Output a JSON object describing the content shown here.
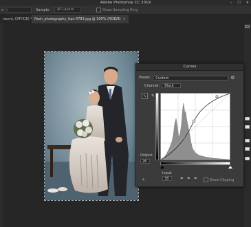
{
  "window": {
    "title": "Adobe Photoshop CC 2019",
    "controls": [
      "–",
      "☐",
      "✕"
    ]
  },
  "options_bar": {
    "sample_label": "Sample:",
    "sample_value": "All Layers",
    "show_sampling_ring": "Show Sampling Ring"
  },
  "tabs": [
    {
      "label": "round, CMYK/8) *",
      "active": false
    },
    {
      "label": "flash_photography_tips-0783.jpg @ 100% (RGB/8)",
      "active": true
    }
  ],
  "curves": {
    "title": "Curves",
    "preset_label": "Preset:",
    "preset_value": "Custom",
    "channel_label": "Channel:",
    "channel_value": "Black",
    "output_label": "Output:",
    "output_value": "26",
    "input_label": "Input:",
    "input_value": "38",
    "show_clipping": "Show Clipping"
  },
  "icons": {
    "curve_tool": "curve-point-icon",
    "pencil_tool": "pencil-icon",
    "auto": "auto-adjust-icon",
    "black_eyedropper": "black-eyedropper-icon",
    "gray_eyedropper": "gray-eyedropper-icon",
    "white_eyedropper": "white-eyedropper-icon",
    "gear": "gear-icon"
  },
  "colors": {
    "accent": "#3b3b3b",
    "canvas_bg": "#262626"
  }
}
